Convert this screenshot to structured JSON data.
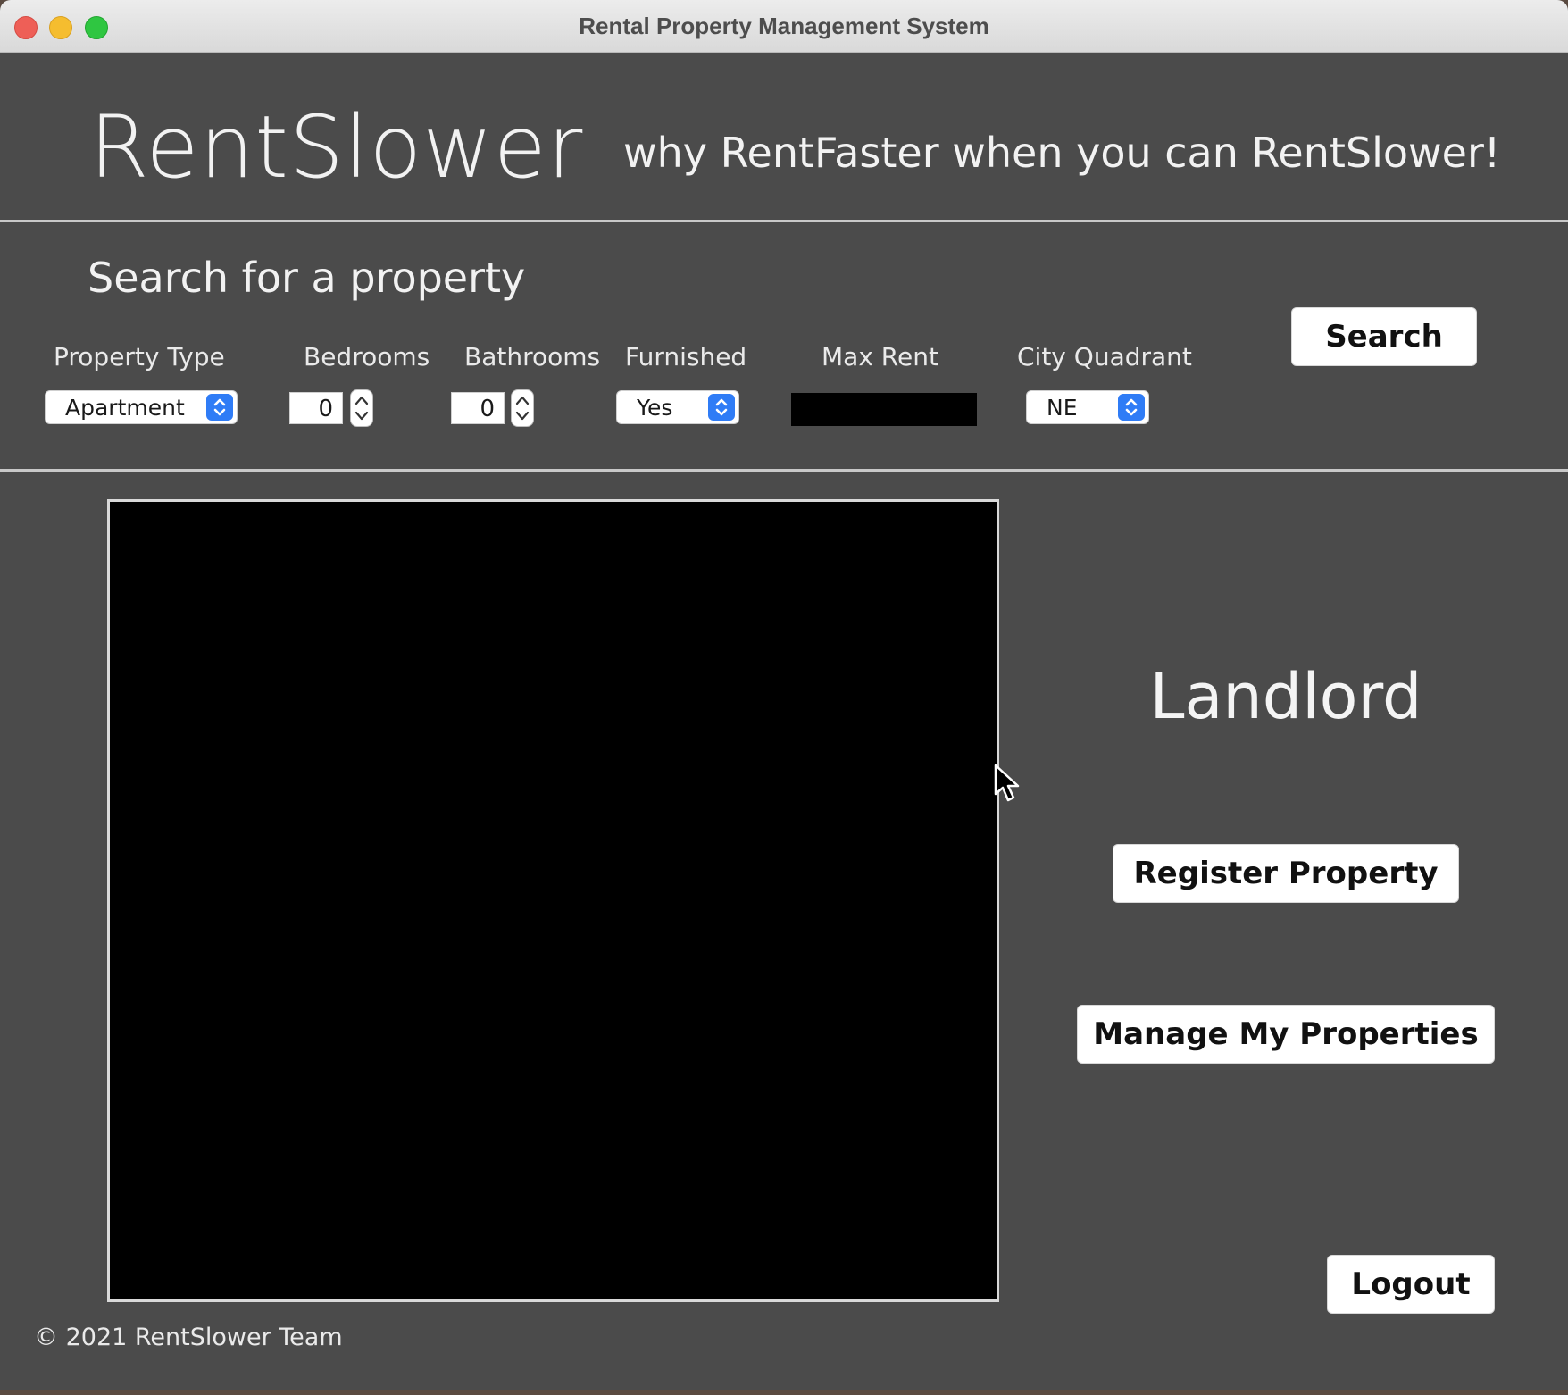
{
  "window": {
    "title": "Rental Property Management System"
  },
  "header": {
    "brand": "RentSlower",
    "slogan": "why RentFaster when you can RentSlower!"
  },
  "search": {
    "title": "Search for a property",
    "fields": {
      "property_type": {
        "label": "Property Type",
        "value": "Apartment"
      },
      "bedrooms": {
        "label": "Bedrooms",
        "value": "0"
      },
      "bathrooms": {
        "label": "Bathrooms",
        "value": "0"
      },
      "furnished": {
        "label": "Furnished",
        "value": "Yes"
      },
      "max_rent": {
        "label": "Max Rent",
        "value": ""
      },
      "city_quadrant": {
        "label": "City Quadrant",
        "value": "NE"
      }
    },
    "button_label": "Search"
  },
  "landlord": {
    "role_label": "Landlord",
    "register_label": "Register Property",
    "manage_label": "Manage My Properties",
    "logout_label": "Logout"
  },
  "footer": {
    "copyright": "© 2021 RentSlower Team"
  },
  "icons": {
    "select_arrows": "chevron-up-down-icon",
    "stepper": "stepper-arrows-icon",
    "cursor": "mouse-pointer-icon"
  },
  "colors": {
    "window_bg": "#4b4b4b",
    "accent_blue": "#2f7cf6",
    "text_light": "#f2f2f2"
  }
}
